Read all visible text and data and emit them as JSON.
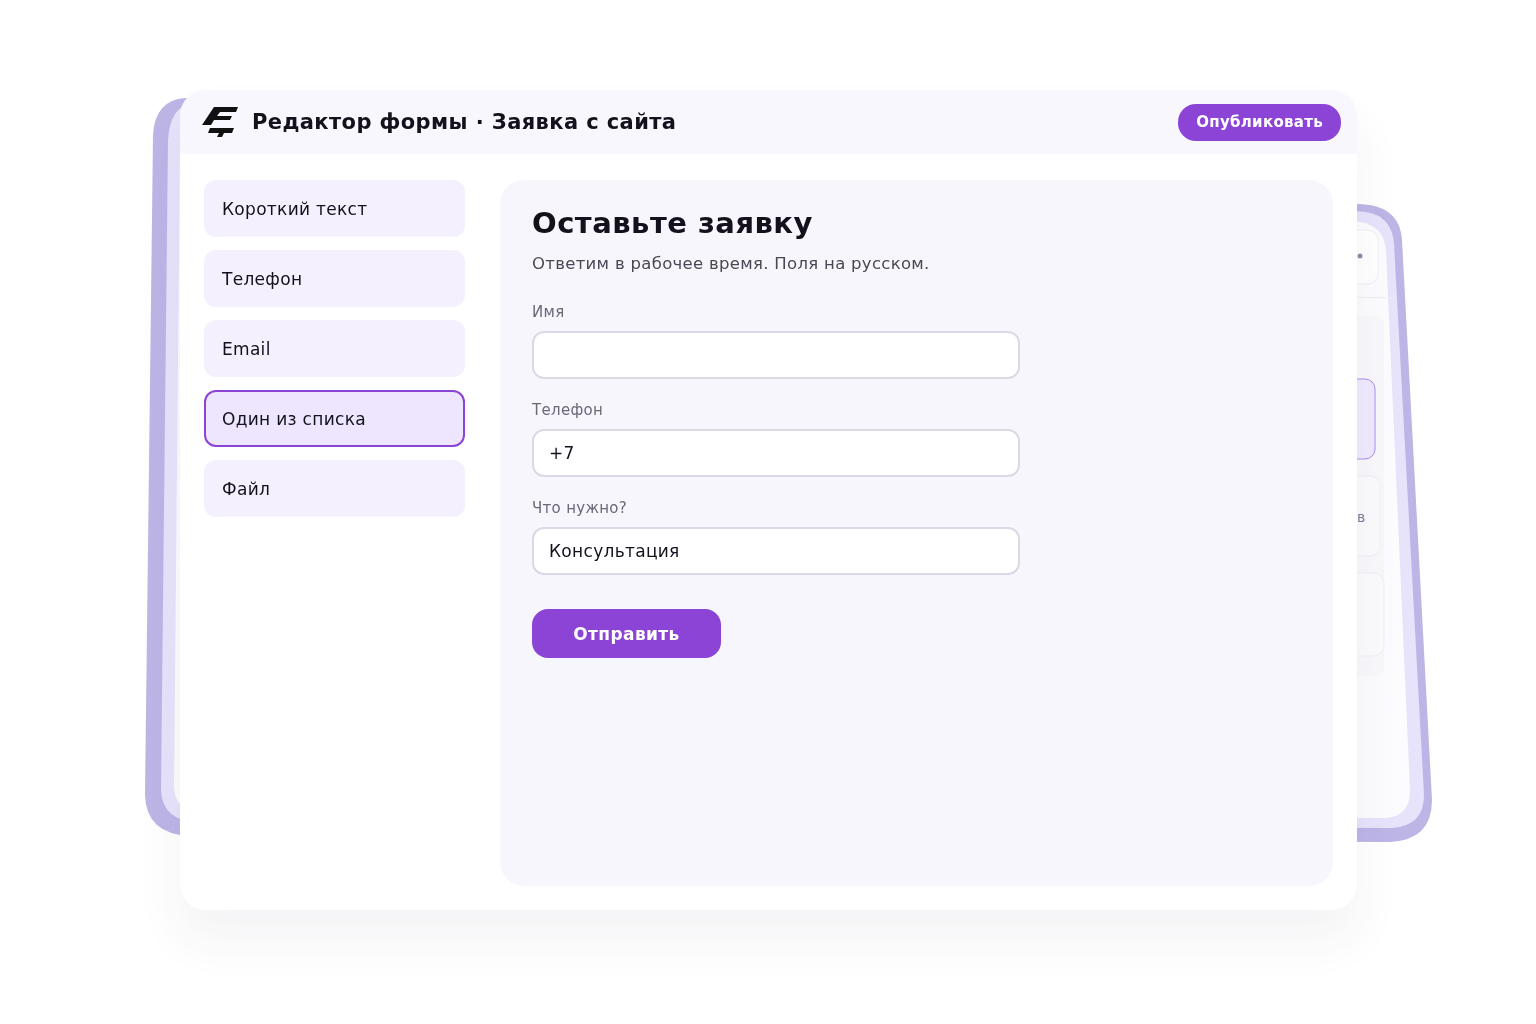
{
  "header": {
    "title": "Редактор формы · Заявка с сайта",
    "publish_button": "Опубликовать"
  },
  "sidebar": {
    "items": [
      {
        "label": "Короткий текст",
        "selected": false
      },
      {
        "label": "Телефон",
        "selected": false
      },
      {
        "label": "Email",
        "selected": false
      },
      {
        "label": "Один из списка",
        "selected": true
      },
      {
        "label": "Файл",
        "selected": false
      }
    ]
  },
  "form": {
    "title": "Оставьте заявку",
    "subtitle": "Ответим в рабочее время. Поля на русском.",
    "fields": [
      {
        "label": "Имя"
      },
      {
        "label": "Телефон",
        "value": "+7"
      },
      {
        "label": "Что нужно?",
        "value": "Консультация"
      }
    ],
    "submit_button": "Отправить"
  },
  "background_device": {
    "fragment": "в"
  }
}
